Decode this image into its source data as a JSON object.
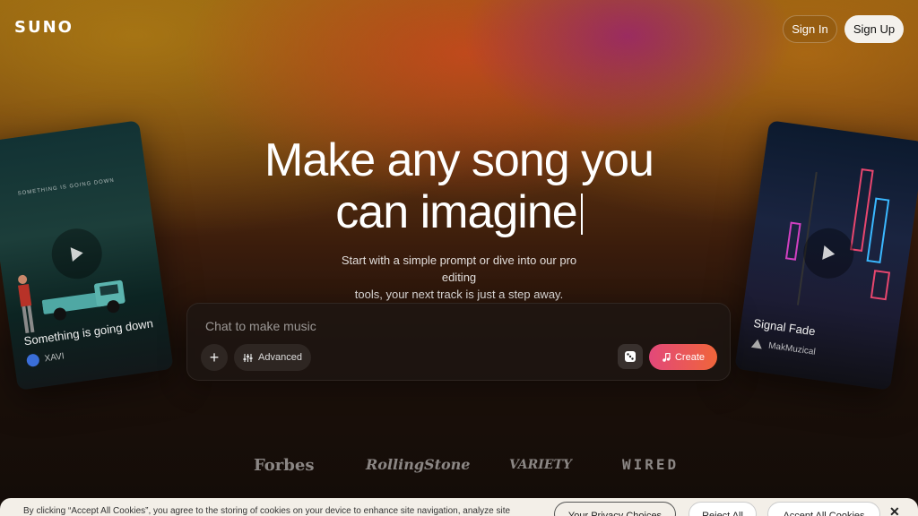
{
  "header": {
    "logo": "SUNO",
    "sign_in": "Sign In",
    "sign_up": "Sign Up"
  },
  "hero": {
    "title_line1": "Make any song you",
    "title_line2": "can imagine",
    "subtitle_line1": "Start with a simple prompt or dive into our pro editing",
    "subtitle_line2": "tools, your next track is just a step away."
  },
  "prompt": {
    "placeholder": "Chat to make music",
    "add_label": "+",
    "advanced_label": "Advanced",
    "create_label": "Create"
  },
  "cards": {
    "left": {
      "caption": "SOMETHING IS GOING DOWN",
      "title": "Something is going down",
      "artist": "XAVI"
    },
    "right": {
      "title": "Signal Fade",
      "artist": "MakMuzical"
    }
  },
  "press": {
    "forbes": "Forbes",
    "rolling_stone": "RollingStone",
    "variety": "VARIETY",
    "wired": "WIRED"
  },
  "cookie": {
    "text": "By clicking “Accept All Cookies”, you agree to the storing of cookies on your device to enhance site navigation, analyze site",
    "privacy": "Your Privacy Choices",
    "reject": "Reject All",
    "accept": "Accept All Cookies",
    "close": "✕"
  },
  "colors": {
    "create_gradient_start": "#e2487a",
    "create_gradient_end": "#f0653a",
    "signup_bg": "#f4f1ec"
  }
}
